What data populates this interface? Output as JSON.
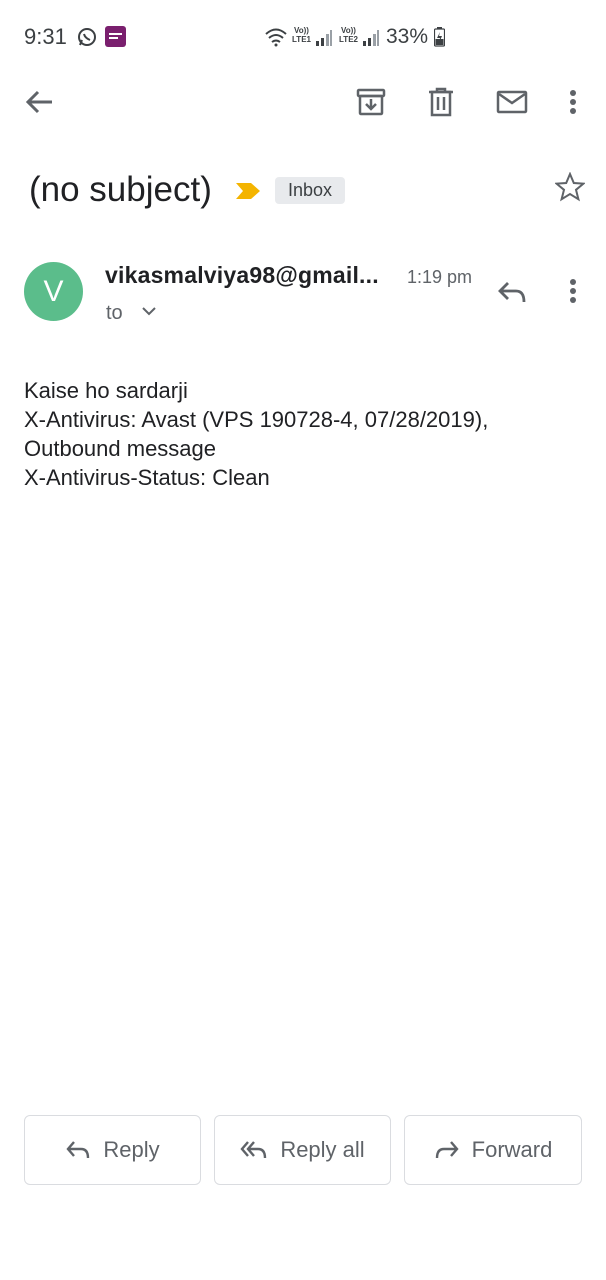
{
  "status_bar": {
    "time": "9:31",
    "sim1_label": [
      "Vo))",
      "LTE1"
    ],
    "sim2_label": [
      "Vo))",
      "LTE2"
    ],
    "battery": "33%"
  },
  "toolbar": {
    "back_icon": "arrow-left-icon",
    "archive_icon": "archive-icon",
    "delete_icon": "trash-icon",
    "mark_unread_icon": "mail-icon",
    "more_icon": "more-vert-icon"
  },
  "email": {
    "subject": "(no subject)",
    "label_chip": "Inbox",
    "sender_initial": "V",
    "sender": "vikasmalviya98@gmail...",
    "time": "1:19 pm",
    "to_label": "to",
    "body": "Kaise ho sardarji\nX-Antivirus: Avast (VPS 190728-4, 07/28/2019),\nOutbound message\nX-Antivirus-Status: Clean"
  },
  "actions": {
    "reply": "Reply",
    "reply_all": "Reply all",
    "forward": "Forward"
  },
  "colors": {
    "avatar": "#5bbd8b",
    "importance_marker": "#f4b400",
    "icon_gray": "#5f6368"
  }
}
